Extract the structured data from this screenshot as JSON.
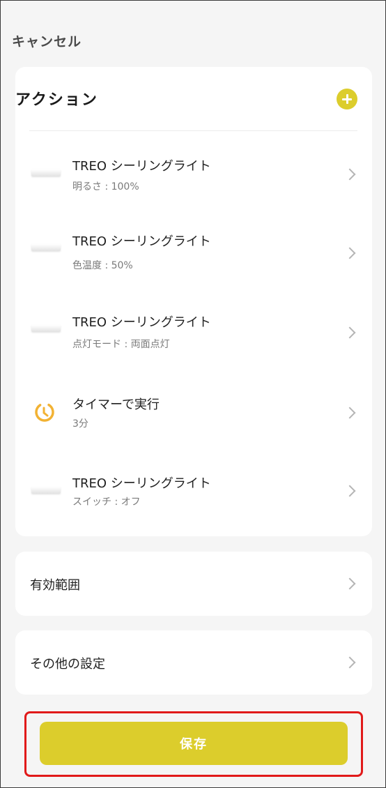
{
  "header": {
    "cancel_label": "キャンセル"
  },
  "actions": {
    "title": "アクション",
    "add_icon": "plus-circle-icon",
    "accent_color": "#dccd2c",
    "items": [
      {
        "icon": "ceiling-light-icon",
        "title": " TREO シーリングライト",
        "subtitle": "明るさ : 100%"
      },
      {
        "icon": "ceiling-light-icon",
        "title": "TREO シーリングライト",
        "subtitle": "色温度 : 50%"
      },
      {
        "icon": "ceiling-light-icon",
        "title": "TREO シーリングライト",
        "subtitle": "点灯モード : 両面点灯"
      },
      {
        "icon": "timer-icon",
        "title": "タイマーで実行",
        "subtitle": "3分"
      },
      {
        "icon": "ceiling-light-icon",
        "title": "TREO シーリングライト",
        "subtitle": "スイッチ : オフ"
      }
    ]
  },
  "scope": {
    "label": "有効範囲"
  },
  "other_settings": {
    "label": "その他の設定"
  },
  "save": {
    "label": "保存"
  }
}
